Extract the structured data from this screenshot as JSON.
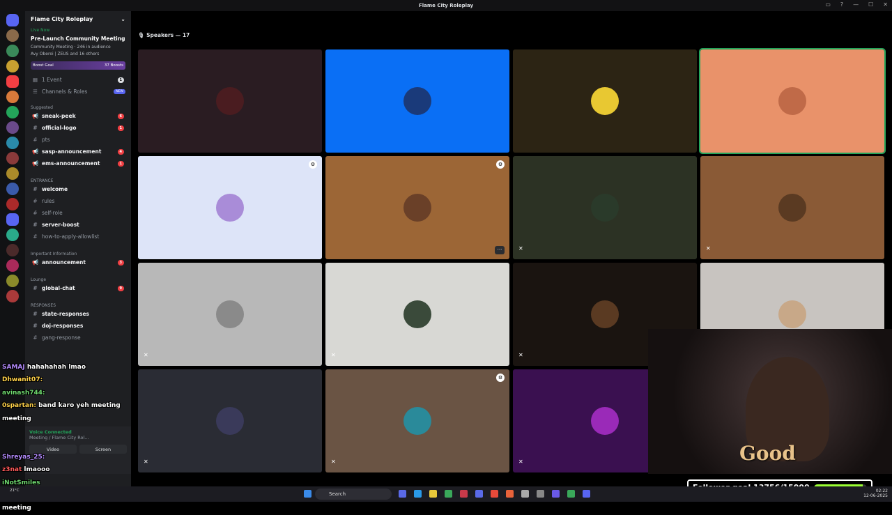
{
  "window": {
    "title": "Flame City Roleplay"
  },
  "sidebar": {
    "server_name": "Flame City Roleplay",
    "live_label": "Live Now",
    "event_title": "Pre-Launch Community Meeting",
    "event_meta": "Community Meeting · 246 in audience",
    "event_people": "Avy Oberoi | ZEUS and 16 others",
    "boost_label": "Boost Goal",
    "boost_count": "37 Boosts",
    "events_label": "1 Event",
    "events_count": "1",
    "channels_roles": "Channels & Roles",
    "new_badge": "NEW",
    "suggested": "Suggested",
    "items": [
      {
        "name": "sneak-peek",
        "count": "6"
      },
      {
        "name": "official-logo",
        "count": "1"
      },
      {
        "name": "pts",
        "count": ""
      },
      {
        "name": "sasp-announcement",
        "count": "4"
      },
      {
        "name": "ems-announcement",
        "count": "1"
      }
    ],
    "cat_entrance": "ENTRANCE",
    "entrance_items": [
      {
        "name": "welcome"
      },
      {
        "name": "rules"
      },
      {
        "name": "self-role"
      },
      {
        "name": "server-boost"
      },
      {
        "name": "how-to-apply-allowlist"
      }
    ],
    "cat_important": "Important Information",
    "announcement": {
      "name": "announcement",
      "count": "3"
    },
    "cat_lounge": "Lounge",
    "global_chat": {
      "name": "global-chat",
      "count": "9"
    },
    "cat_responses": "RESPONSES",
    "responses": [
      {
        "name": "state-responses"
      },
      {
        "name": "doj-responses"
      },
      {
        "name": "gang-response"
      }
    ]
  },
  "voice": {
    "status": "Voice Connected",
    "location": "Meeting / Flame City Rol...",
    "video": "Video",
    "screen": "Screen"
  },
  "stage": {
    "speakers_label": "Speakers — 17"
  },
  "tiles": [
    {
      "bg": "#2a1c22",
      "av": "#4a1c20"
    },
    {
      "bg": "#0a6ff5",
      "av": "#1a3a7a"
    },
    {
      "bg": "#2c2414",
      "av": "#e8c832"
    },
    {
      "bg": "#e9926a",
      "av": "#c06a48"
    },
    {
      "bg": "#dde4f8",
      "av": "#a98cd8"
    },
    {
      "bg": "#9c6636",
      "av": "#6a4028"
    },
    {
      "bg": "#2c3224",
      "av": "#2a3a2a"
    },
    {
      "bg": "#8a5a36",
      "av": "#5a3a22"
    },
    {
      "bg": "#b8b8b8",
      "av": "#8a8a8a"
    },
    {
      "bg": "#d8d8d4",
      "av": "#3a4a3a"
    },
    {
      "bg": "#1a1410",
      "av": "#5a3a22"
    },
    {
      "bg": "#c8c4c0",
      "av": "#c8a888"
    },
    {
      "bg": "#2a2c34",
      "av": "#3a3a5a"
    },
    {
      "bg": "#6a5444",
      "av": "#2a8a9a"
    },
    {
      "bg": "#3a1050",
      "av": "#9a2ab8"
    }
  ],
  "chat": [
    {
      "user": "SAMAJ",
      "msg": "hahahahah lmao",
      "color": "#b58cff"
    },
    {
      "user": "Dhwanit07:",
      "msg": "",
      "color": "#ffd24a"
    },
    {
      "user": "avinash744:",
      "msg": "",
      "color": "#6ed86e"
    },
    {
      "user": "0spartan:",
      "msg": "band karo yeh meeting meeting",
      "color": "#ffd24a"
    },
    {
      "user": "",
      "msg": "",
      "color": "#ff5a5a"
    },
    {
      "user": "",
      "msg": "",
      "color": "#ff5a5a"
    },
    {
      "user": "Shreyas_25:",
      "msg": "",
      "color": "#b58cff"
    },
    {
      "user": "z3nat",
      "msg": "lmaooo",
      "color": "#ff5a5a"
    },
    {
      "user": "iNotSmiles",
      "msg": "",
      "color": "#6ed86e"
    },
    {
      "user": "0spartan:",
      "msg": "band karo yeh meeting meeting",
      "color": "#ffd24a"
    }
  ],
  "overlay": {
    "caption": "Good",
    "goal_text": "Follower goal 13756/15000",
    "goal_progress": 0.917
  },
  "taskbar": {
    "search": "Search",
    "weather": "21°C",
    "time": "02:22",
    "date": "12-06-2025"
  }
}
